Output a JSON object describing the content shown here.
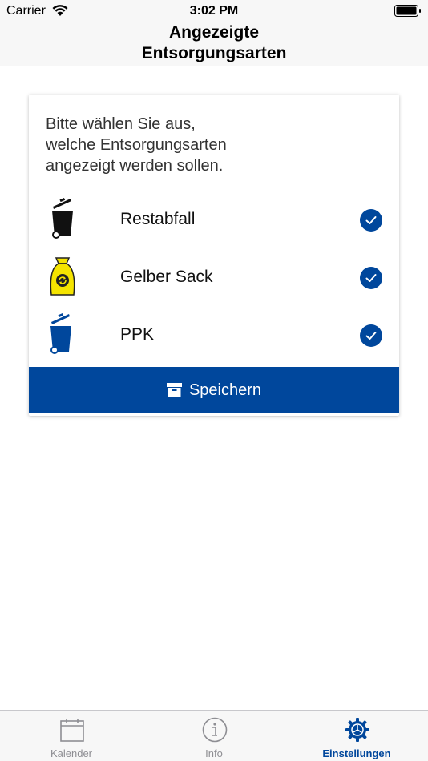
{
  "status_bar": {
    "carrier": "Carrier",
    "time": "3:02 PM"
  },
  "nav": {
    "title": "Angezeigte\nEntsorgungsarten"
  },
  "card": {
    "instruction": "Bitte wählen Sie aus,\nwelche Entsorgungsarten\nangezeigt werden sollen.",
    "items": [
      {
        "label": "Restabfall",
        "icon": "black-trash-bin-icon",
        "color": "#111111",
        "checked": true
      },
      {
        "label": "Gelber Sack",
        "icon": "yellow-sack-icon",
        "color": "#f5e400",
        "checked": true
      },
      {
        "label": "PPK",
        "icon": "blue-trash-bin-icon",
        "color": "#00479c",
        "checked": true
      }
    ],
    "save_label": "Speichern"
  },
  "tabs": [
    {
      "label": "Kalender",
      "icon": "calendar-icon",
      "active": false
    },
    {
      "label": "Info",
      "icon": "info-icon",
      "active": false
    },
    {
      "label": "Einstellungen",
      "icon": "settings-gear-icon",
      "active": true
    }
  ],
  "colors": {
    "accent": "#00479c",
    "inactive": "#8e8e93"
  }
}
